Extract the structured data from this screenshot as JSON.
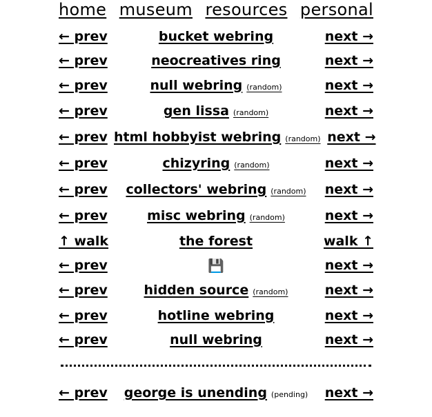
{
  "nav": {
    "items": [
      {
        "label": "home"
      },
      {
        "label": "museum"
      },
      {
        "label": "resources"
      },
      {
        "label": "personal"
      }
    ]
  },
  "rings": [
    {
      "prev": "← prev",
      "name": "bucket webring",
      "random": "",
      "next": "next →"
    },
    {
      "prev": "← prev",
      "name": "neocreatives ring",
      "random": "",
      "next": "next →"
    },
    {
      "prev": "← prev",
      "name": "null webring",
      "random": "(random)",
      "next": "next →"
    },
    {
      "prev": "← prev",
      "name": "gen lissa",
      "random": "(random)",
      "next": "next →"
    },
    {
      "prev": "← prev",
      "name": "html hobbyist webring",
      "random": "(random)",
      "next": "next →"
    },
    {
      "prev": "← prev",
      "name": "chizyring",
      "random": "(random)",
      "next": "next →"
    },
    {
      "prev": "← prev",
      "name": "collectors' webring",
      "random": "(random)",
      "next": "next →"
    },
    {
      "prev": "← prev",
      "name": "misc webring",
      "random": "(random)",
      "next": "next →"
    },
    {
      "prev": "↑ walk",
      "name": "the forest",
      "random": "",
      "next": "walk ↑"
    },
    {
      "prev": "← prev",
      "name": "💾",
      "random": "",
      "next": "next →"
    },
    {
      "prev": "← prev",
      "name": "hidden source",
      "random": "(random)",
      "next": "next →"
    },
    {
      "prev": "← prev",
      "name": "hotline webring",
      "random": "",
      "next": "next →"
    },
    {
      "prev": "← prev",
      "name": "null webring",
      "random": "",
      "next": "next →"
    }
  ],
  "footer": {
    "prev": "← prev",
    "name": "george is unending",
    "status": "(pending)",
    "next": "next →"
  }
}
